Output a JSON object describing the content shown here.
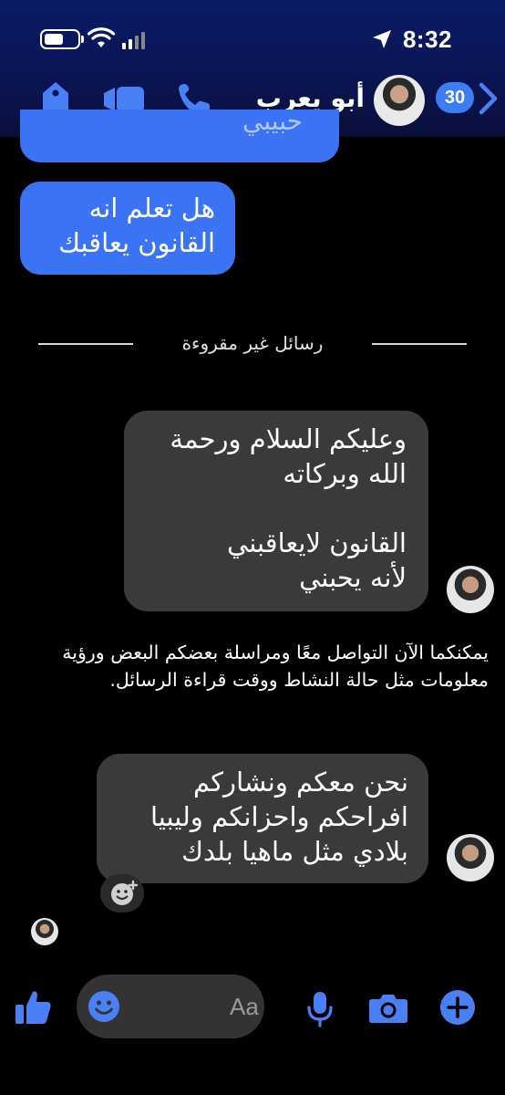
{
  "status_bar": {
    "time": "8:32"
  },
  "header": {
    "contact_name": "أبو يعرب",
    "unread_badge": "30",
    "accent": "#3d7cf2"
  },
  "messages": {
    "cut_off_text": "حبيبي",
    "sent_1": {
      "line1": "هل تعلم انه",
      "line2": "القانون يعاقبك"
    },
    "unread_divider": "رسائل غير مقروءة",
    "received_1": {
      "line1": "وعليكم السلام ورحمة",
      "line2": "الله وبركاته",
      "line3": "القانون لايعاقبني",
      "line4": "لأنه يحبني"
    },
    "system_notice": "يمكنكما الآن التواصل معًا ومراسلة بعضكم البعض ورؤية معلومات مثل حالة النشاط ووقت قراءة الرسائل.",
    "received_2": {
      "line1": "نحن معكم ونشاركم",
      "line2": "افراحكم واحزانكم وليبيا",
      "line3": "بلادي مثل ماهيا بلدك"
    }
  },
  "composer": {
    "placeholder": "Aa"
  },
  "colors": {
    "sent_bubble": "#3b73f5",
    "received_bubble": "#3a3a3c",
    "icon_blue": "#4a80f5"
  },
  "icons": [
    "location-arrow-icon",
    "wifi-icon",
    "battery-icon",
    "signal-icon",
    "tag-icon",
    "video-camera-icon",
    "phone-icon",
    "back-chevron-icon",
    "add-reaction-icon",
    "thumbs-up-icon",
    "emoji-icon",
    "microphone-icon",
    "camera-icon",
    "plus-icon"
  ]
}
